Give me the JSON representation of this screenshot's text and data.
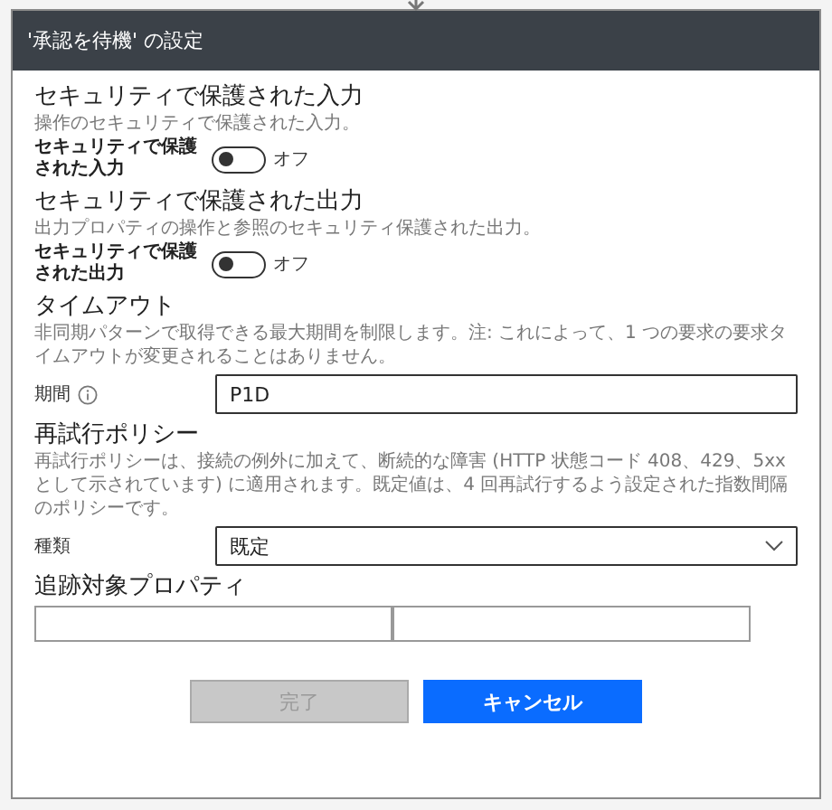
{
  "dialog": {
    "title": "'承認を待機' の設定"
  },
  "toggles": [
    {
      "heading": "セキュリティで保護された入力",
      "description": "操作のセキュリティで保護された入力。",
      "label": "セキュリティで保護された入力",
      "on": false,
      "state_text": "オフ"
    },
    {
      "heading": "セキュリティで保護された出力",
      "description": "出力プロパティの操作と参照のセキュリティ保護された出力。",
      "label": "セキュリティで保護された出力",
      "on": false,
      "state_text": "オフ"
    }
  ],
  "timeout": {
    "heading": "タイムアウト",
    "description": "非同期パターンで取得できる最大期間を制限します。注: これによって、1 つの要求の要求タイムアウトが変更されることはありません。",
    "label": "期間",
    "value": "P1D"
  },
  "retry_policy": {
    "heading": "再試行ポリシー",
    "description": "再試行ポリシーは、接続の例外に加えて、断続的な障害 (HTTP 状態コード 408、429、5xx として示されています) に適用されます。既定値は、4 回再試行するよう設定された指数間隔のポリシーです。",
    "label": "種類",
    "value": "既定"
  },
  "tracked_properties": {
    "heading": "追跡対象プロパティ"
  },
  "buttons": [
    {
      "label": "完了",
      "kind": "secondary",
      "disabled": true
    },
    {
      "label": "キャンセル",
      "kind": "primary",
      "disabled": false
    }
  ]
}
